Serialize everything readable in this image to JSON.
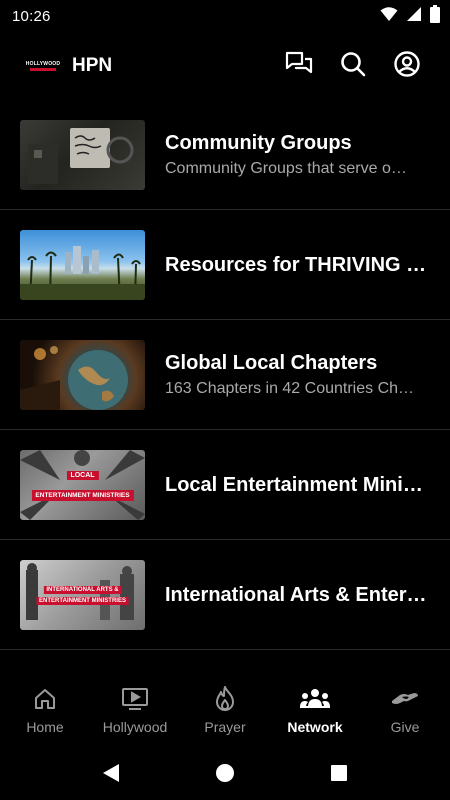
{
  "status_bar": {
    "time": "10:26",
    "icons": [
      "wifi-icon",
      "cellular-signal-icon",
      "battery-icon"
    ]
  },
  "app_bar": {
    "logo_text": "HOLLYWOOD",
    "title": "HPN",
    "actions": [
      "chat-icon",
      "search-icon",
      "account-icon"
    ]
  },
  "list": {
    "items": [
      {
        "title": "Community Groups",
        "subtitle": "Community Groups that serve o…",
        "thumb": "community-groups-thumbnail"
      },
      {
        "title": "Resources for THRIVING i…",
        "subtitle": "",
        "thumb": "resources-thumbnail"
      },
      {
        "title": "Global Local Chapters",
        "subtitle": "163 Chapters in 42 Countries Ch…",
        "thumb": "global-chapters-thumbnail"
      },
      {
        "title": "Local Entertainment Minis…",
        "subtitle": "",
        "thumb": "local-ministries-thumbnail",
        "banner_top": "LOCAL",
        "banner_bottom": "ENTERTAINMENT MINISTRIES"
      },
      {
        "title": "International Arts & Entert…",
        "subtitle": "",
        "thumb": "international-ministries-thumbnail",
        "banner_top": "INTERNATIONAL ARTS &",
        "banner_bottom": "ENTERTAINMENT MINISTRIES"
      }
    ]
  },
  "bottom_nav": {
    "items": [
      {
        "label": "Home",
        "icon": "home-icon",
        "active": false
      },
      {
        "label": "Hollywood",
        "icon": "tv-play-icon",
        "active": false
      },
      {
        "label": "Prayer",
        "icon": "flame-icon",
        "active": false
      },
      {
        "label": "Network",
        "icon": "group-icon",
        "active": true
      },
      {
        "label": "Give",
        "icon": "handshake-icon",
        "active": false
      }
    ]
  },
  "system_nav": [
    "back-icon",
    "home-circle-icon",
    "recents-icon"
  ],
  "colors": {
    "background": "#000000",
    "text_primary": "#ffffff",
    "text_secondary": "#a9a9a9",
    "nav_inactive": "#9a9a9a",
    "brand_red": "#c8102e",
    "divider": "#2a2a2a"
  }
}
